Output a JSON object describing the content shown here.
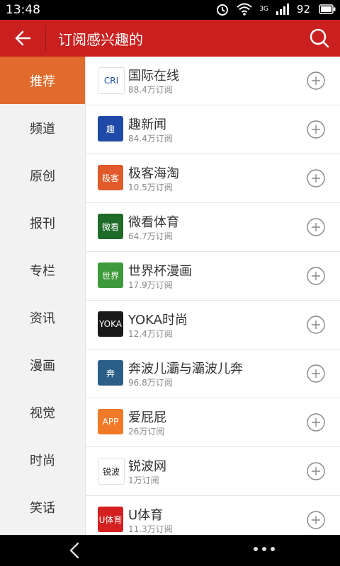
{
  "status": {
    "time": "13:48",
    "battery": "92",
    "network": "3G"
  },
  "header": {
    "title": "订阅感兴趣的"
  },
  "categories": [
    {
      "label": "推荐"
    },
    {
      "label": "频道"
    },
    {
      "label": "原创"
    },
    {
      "label": "报刊"
    },
    {
      "label": "专栏"
    },
    {
      "label": "资讯"
    },
    {
      "label": "漫画"
    },
    {
      "label": "视觉"
    },
    {
      "label": "时尚"
    },
    {
      "label": "笑话"
    }
  ],
  "items": [
    {
      "name": "国际在线",
      "count": "88.4万订阅",
      "logo": "CRI",
      "logo_bg": "#ffffff",
      "logo_fg": "#1b4fa0"
    },
    {
      "name": "趣新闻",
      "count": "84.4万订阅",
      "logo": "趣",
      "logo_bg": "#1f4aa8",
      "logo_fg": "#ffffff"
    },
    {
      "name": "极客海淘",
      "count": "10.5万订阅",
      "logo": "极客",
      "logo_bg": "#e05a2b",
      "logo_fg": "#ffffff"
    },
    {
      "name": "微看体育",
      "count": "64.7万订阅",
      "logo": "微看",
      "logo_bg": "#1f6b2a",
      "logo_fg": "#ffffff"
    },
    {
      "name": "世界杯漫画",
      "count": "17.9万订阅",
      "logo": "世界",
      "logo_bg": "#3d9a3a",
      "logo_fg": "#ffffff"
    },
    {
      "name": "YOKA时尚",
      "count": "12.4万订阅",
      "logo": "YOKA",
      "logo_bg": "#1a1a1a",
      "logo_fg": "#ffffff"
    },
    {
      "name": "奔波儿灞与灞波儿奔",
      "count": "96.8万订阅",
      "logo": "奔",
      "logo_bg": "#2c5f88",
      "logo_fg": "#ffffff"
    },
    {
      "name": "爱屁屁",
      "count": "26万订阅",
      "logo": "APP",
      "logo_bg": "#f07a28",
      "logo_fg": "#ffffff"
    },
    {
      "name": "锐波网",
      "count": "1万订阅",
      "logo": "锐波",
      "logo_bg": "#ffffff",
      "logo_fg": "#222222"
    },
    {
      "name": "U体育",
      "count": "11.3万订阅",
      "logo": "U体育",
      "logo_bg": "#d42020",
      "logo_fg": "#ffffff"
    }
  ],
  "colors": {
    "header": "#c9201f",
    "active_category": "#e06b2c"
  }
}
